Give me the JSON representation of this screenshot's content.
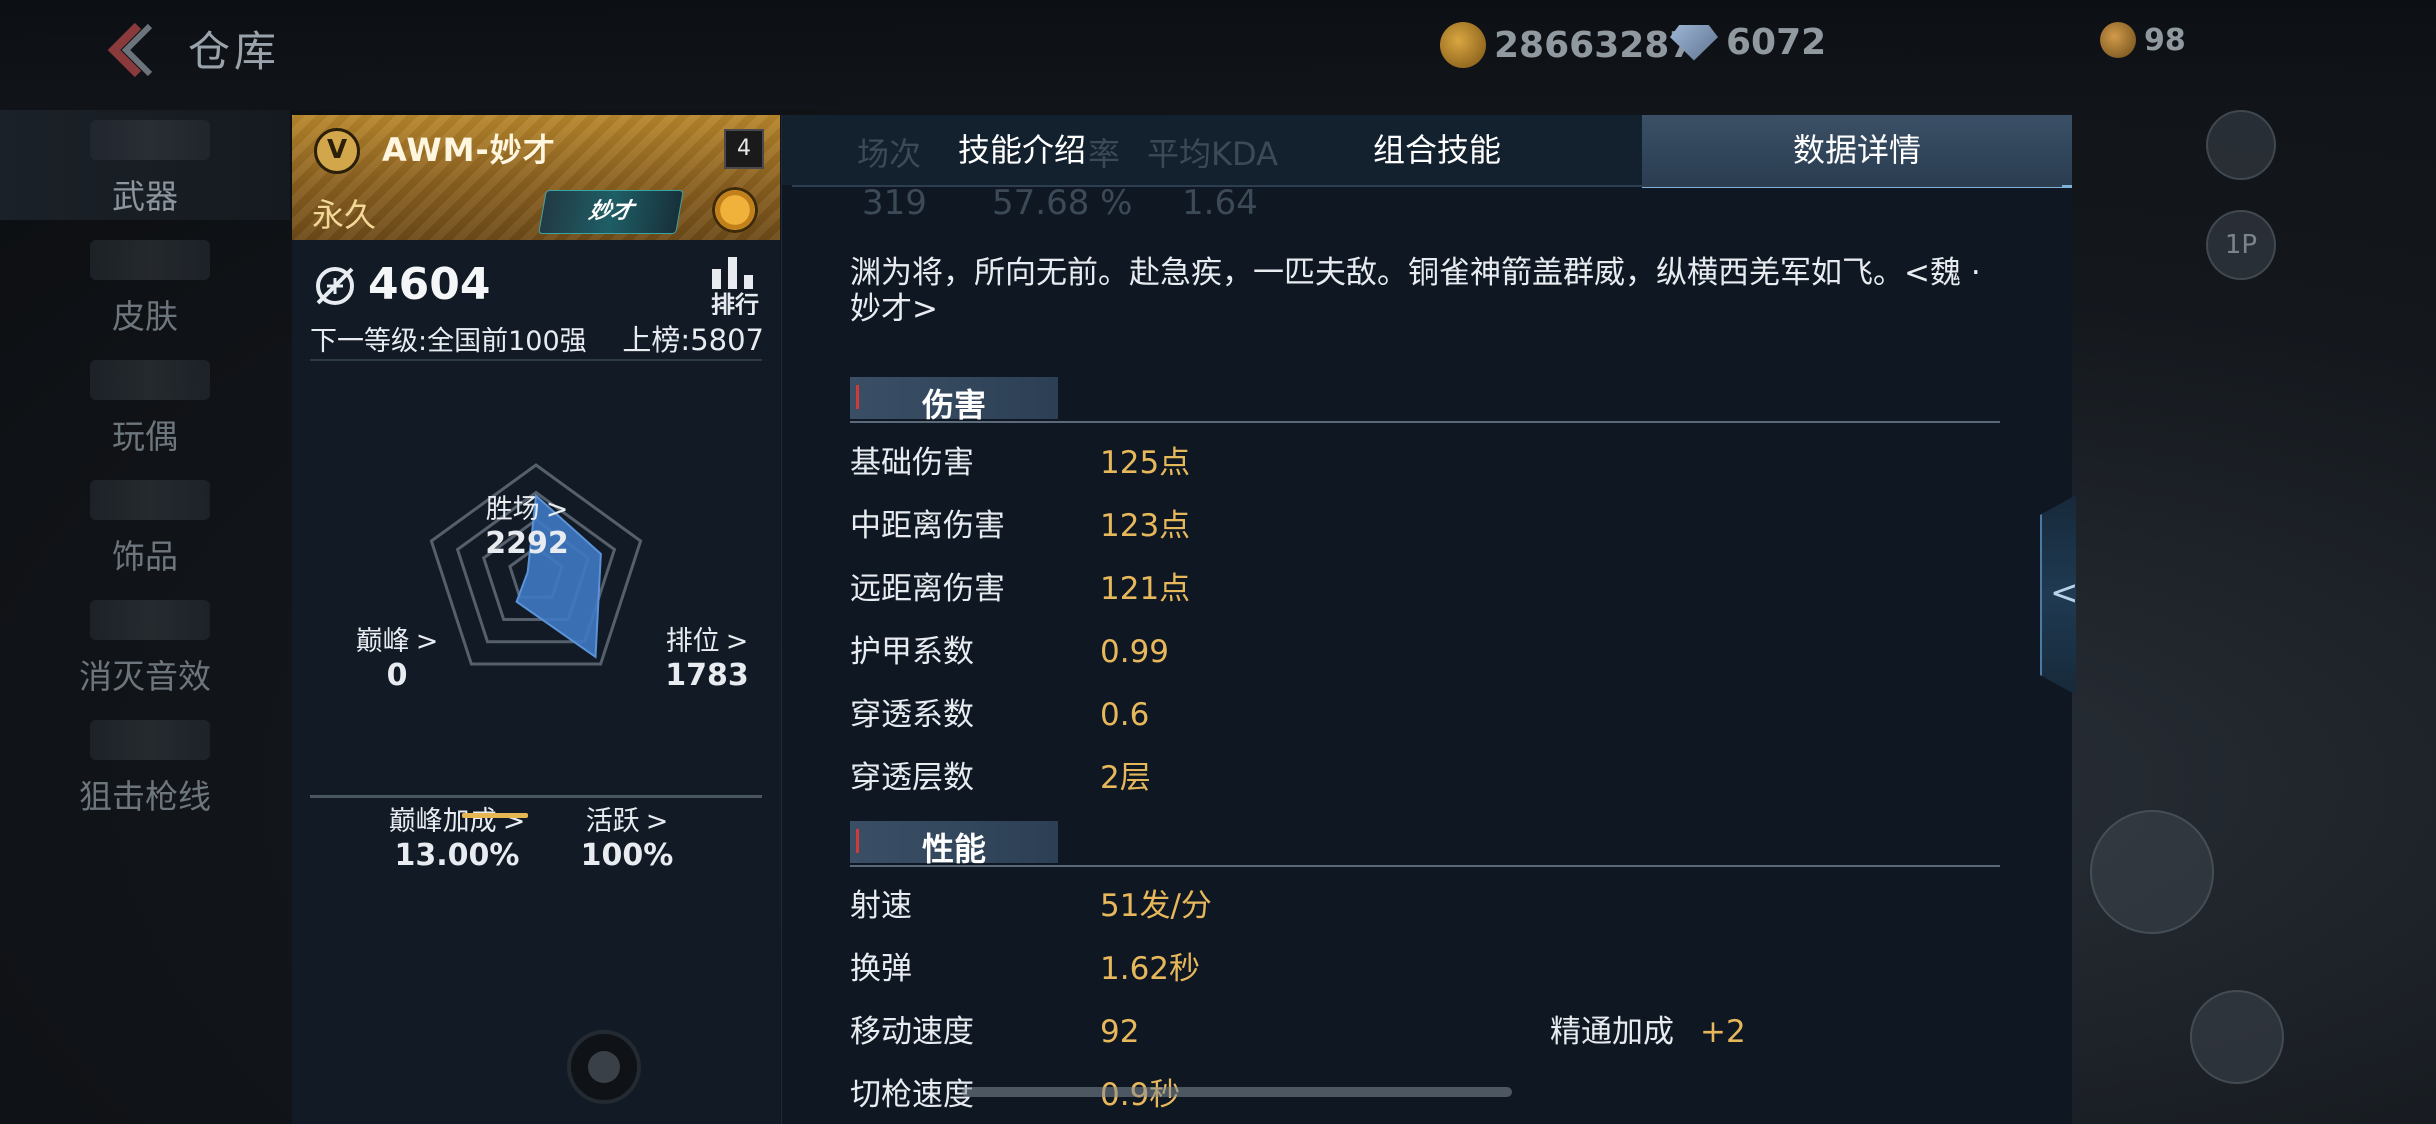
{
  "header": {
    "title": "仓库",
    "gold": "28663287",
    "diamonds": "6072",
    "coupons": "98"
  },
  "nav": [
    "武器",
    "皮肤",
    "玩偶",
    "饰品",
    "消灭音效",
    "狙击枪线"
  ],
  "right_deco": {
    "button_1p": "1P"
  },
  "weapon": {
    "name": "AWM-妙才",
    "level": "4",
    "duration": "永久",
    "tag": "妙才",
    "score": "4604",
    "rank_label": "排行",
    "next_level": "下一等级:全国前100强",
    "on_board": "上榜:5807",
    "radar": {
      "wins": {
        "label": "胜场",
        "value": "2292"
      },
      "rank": {
        "label": "排位",
        "value": "1783"
      },
      "active": {
        "label": "活跃",
        "value": "100%"
      },
      "peak_bonus": {
        "label": "巅峰加成",
        "value": "13.00%"
      },
      "peak": {
        "label": "巅峰",
        "value": "0"
      },
      "levels": {
        "wins": 0.72,
        "rank": 0.62,
        "active": 0.92,
        "peak_bonus": 0.3,
        "peak": 0.08
      }
    }
  },
  "tabs": {
    "skill_intro": "技能介绍",
    "combo_skill": "组合技能",
    "data_details": "数据详情"
  },
  "ghost_stats": {
    "h1": "场次",
    "h2": "率",
    "h3": "平均KDA",
    "v1": "319",
    "v2": "57.68 %",
    "v3": "1.64"
  },
  "description": "渊为将，所向无前。赴急疾，一匹夫敌。铜雀神箭盖群威，纵横西羌军如飞。<魏 · 妙才>",
  "sections": {
    "damage": {
      "title": "伤害",
      "rows": [
        {
          "k": "基础伤害",
          "v": "125点"
        },
        {
          "k": "中距离伤害",
          "v": "123点"
        },
        {
          "k": "远距离伤害",
          "v": "121点"
        },
        {
          "k": "护甲系数",
          "v": "0.99"
        },
        {
          "k": "穿透系数",
          "v": "0.6"
        },
        {
          "k": "穿透层数",
          "v": "2层"
        }
      ]
    },
    "performance": {
      "title": "性能",
      "rows": [
        {
          "k": "射速",
          "v": "51发/分"
        },
        {
          "k": "换弹",
          "v": "1.62秒"
        },
        {
          "k": "移动速度",
          "v": "92",
          "ek": "精通加成",
          "ev": "+2"
        },
        {
          "k": "切枪速度",
          "v": "0.9秒"
        }
      ]
    }
  },
  "colors": {
    "accent_gold": "#e7b85b",
    "panel_bg": "#0e1722",
    "tab_active": "#3b5066"
  }
}
